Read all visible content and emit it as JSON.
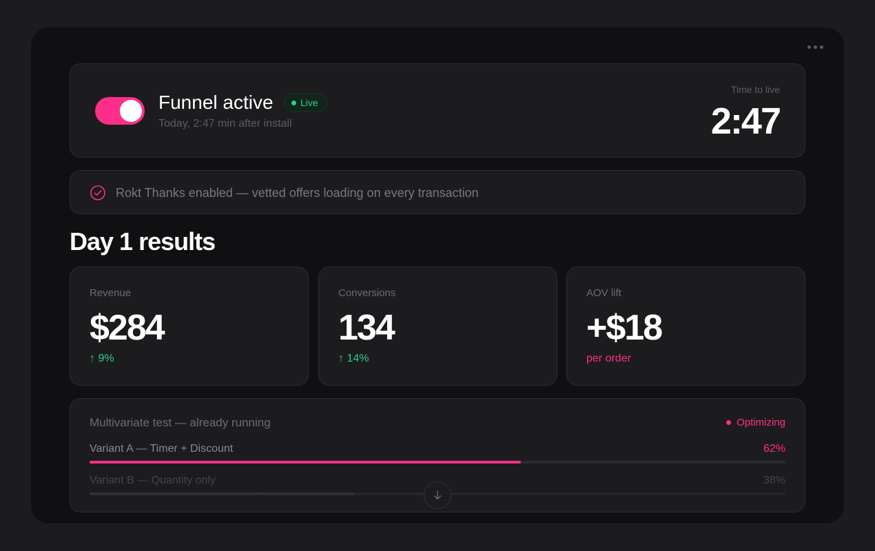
{
  "header": {
    "toggle_on": true,
    "title": "Funnel active",
    "badge": "Live",
    "subtitle": "Today, 2:47 min after install",
    "time_label": "Time to live",
    "time_value": "2:47"
  },
  "notice": {
    "icon": "check-circle-icon",
    "text": "Rokt Thanks enabled — vetted offers loading on every transaction"
  },
  "section_title": "Day 1 results",
  "stats": [
    {
      "label": "Revenue",
      "value": "$284",
      "delta": "↑ 9%"
    },
    {
      "label": "Conversions",
      "value": "134",
      "delta": "↑ 14%"
    },
    {
      "label": "AOV lift",
      "value": "+$18",
      "delta": "per order"
    }
  ],
  "test": {
    "title": "Multivariate test — already running",
    "status": "Optimizing",
    "variants": [
      {
        "label": "Variant A — Timer + Discount",
        "pct": "62%",
        "share": 0.62
      },
      {
        "label": "Variant B — Quantity only",
        "pct": "38%",
        "share": 0.38
      }
    ]
  },
  "colors": {
    "accent": "#ff2f89",
    "positive": "#2fce88",
    "background": "#100f11",
    "card": "#1c1b1e"
  }
}
